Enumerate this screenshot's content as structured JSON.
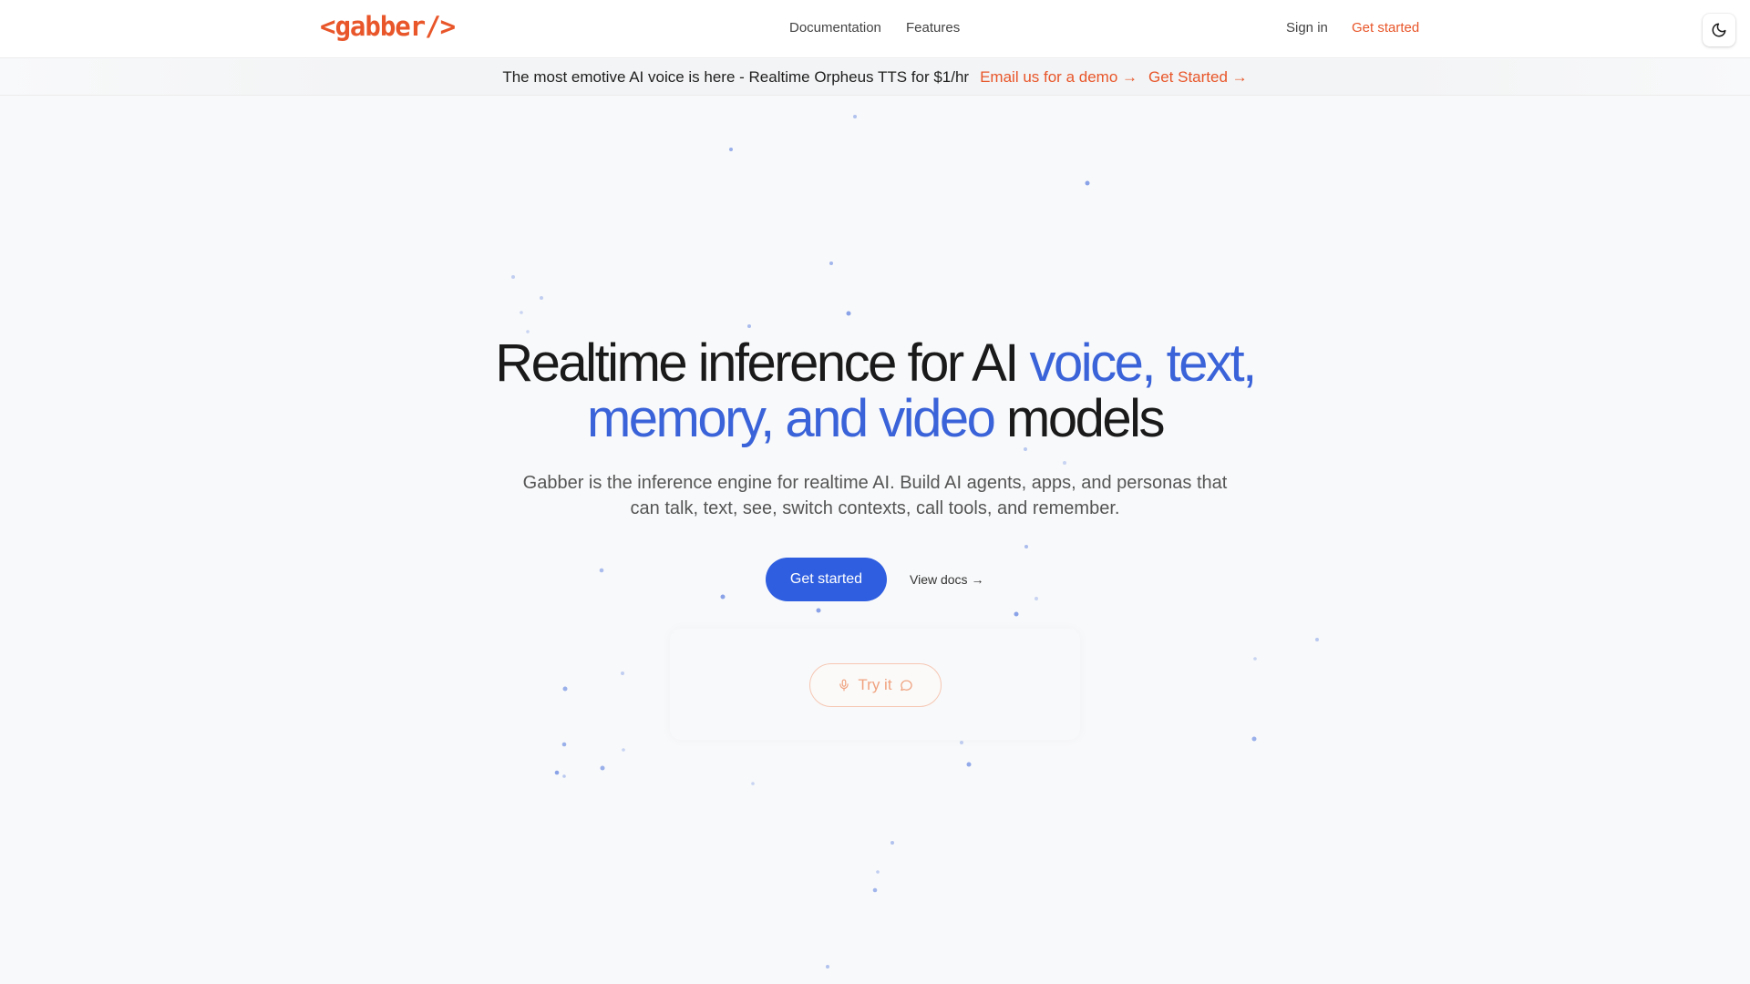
{
  "header": {
    "logo": "<gabber/>",
    "nav": [
      "Documentation",
      "Features"
    ],
    "sign_in": "Sign in",
    "get_started": "Get started"
  },
  "banner": {
    "text": "The most emotive AI voice is here - Realtime Orpheus TTS for $1/hr",
    "demo_link": "Email us for a demo →",
    "start_link": "Get Started →"
  },
  "hero": {
    "title_part1": "Realtime inference for AI ",
    "title_accent1": "voice, text,",
    "title_accent2": "memory, and video",
    "title_part2": " models",
    "subtitle": "Gabber is the inference engine for realtime AI. Build AI agents, apps, and personas that can talk, text, see, switch contexts, call tools, and remember.",
    "cta_primary": "Get started",
    "cta_secondary": "View docs →",
    "try_it": "Try it"
  },
  "colors": {
    "brand_orange": "#e8562a",
    "accent_blue": "#3b63d9",
    "button_blue": "#2f5ee0"
  },
  "icons": [
    "moon-icon",
    "microphone-icon",
    "chat-bubble-icon"
  ]
}
